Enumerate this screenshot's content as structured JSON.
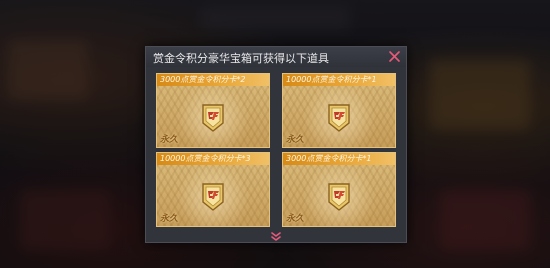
{
  "dialog": {
    "title": "赏金令积分豪华宝箱可获得以下道具",
    "close_icon": "close-icon",
    "expand_icon": "chevron-double-down-icon"
  },
  "items": [
    {
      "label": "3000点赏金令积分卡*2",
      "duration": "永久",
      "icon": "cf-badge-icon"
    },
    {
      "label": "10000点赏金令积分卡*1",
      "duration": "永久",
      "icon": "cf-badge-icon"
    },
    {
      "label": "10000点赏金令积分卡*3",
      "duration": "永久",
      "icon": "cf-badge-icon"
    },
    {
      "label": "3000点赏金令积分卡*1",
      "duration": "永久",
      "icon": "cf-badge-icon"
    }
  ],
  "colors": {
    "card_header": "#e09a2a",
    "card_body": "#c9a25e",
    "accent": "#e85a7a"
  }
}
